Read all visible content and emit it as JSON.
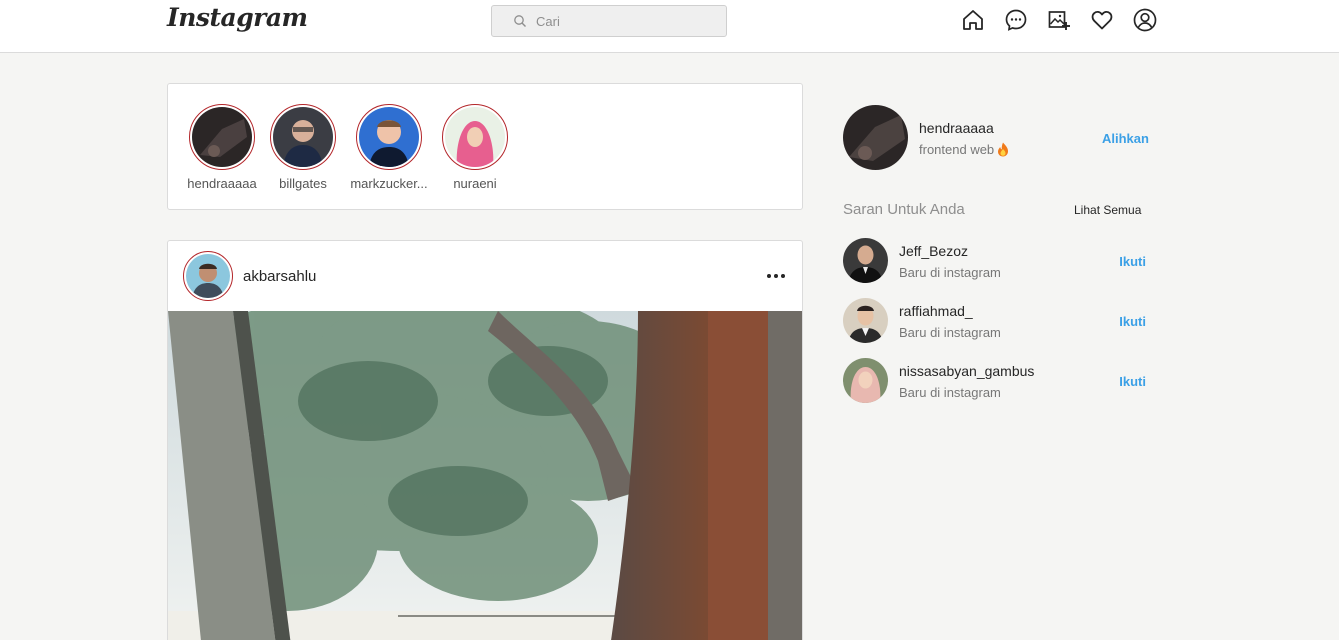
{
  "header": {
    "logo": "Instagram",
    "search_placeholder": "Cari",
    "nav_icons": [
      "home-icon",
      "messenger-icon",
      "new-post-icon",
      "heart-icon",
      "profile-icon"
    ]
  },
  "stories": [
    {
      "name": "hendraaaaa"
    },
    {
      "name": "billgates"
    },
    {
      "name": "markzucker..."
    },
    {
      "name": "nuraeni"
    }
  ],
  "post": {
    "username": "akbarsahlu"
  },
  "sidebar": {
    "username": "hendraaaaa",
    "bio": "frontend web",
    "bio_emoji": "fire-emoji",
    "switch_label": "Alihkan",
    "suggestions_title": "Saran Untuk Anda",
    "see_all_label": "Lihat Semua",
    "suggestions": [
      {
        "username": "Jeff_Bezoz",
        "subtitle": "Baru di instagram",
        "action": "Ikuti"
      },
      {
        "username": "raffiahmad_",
        "subtitle": "Baru di instagram",
        "action": "Ikuti"
      },
      {
        "username": "nissasabyan_gambus",
        "subtitle": "Baru di instagram",
        "action": "Ikuti"
      }
    ]
  },
  "colors": {
    "accent_link": "#3ba0e6",
    "story_ring": "#b3262a",
    "page_bg": "#f5f5f3"
  }
}
